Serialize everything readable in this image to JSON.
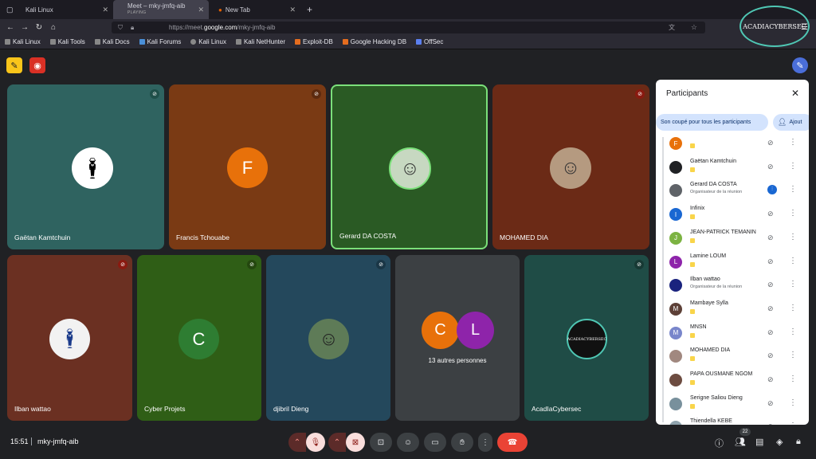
{
  "tabs": [
    {
      "label": "Kali Linux"
    },
    {
      "label": "Meet – mky-jmfq-aib",
      "sub": "PLAYING"
    },
    {
      "label": "New Tab"
    }
  ],
  "url": {
    "prefix": "https://meet.",
    "domain": "google.com",
    "path": "/mky-jmfq-aib"
  },
  "bookmarks": [
    "Kali Linux",
    "Kali Tools",
    "Kali Docs",
    "Kali Forums",
    "Kali Linux",
    "Kali NetHunter",
    "Exploit-DB",
    "Google Hacking DB",
    "OffSec"
  ],
  "watermark": "ACADIACYBERSEC",
  "tiles": [
    {
      "name": "Gaëtan Kamtchuin",
      "avatar": "",
      "bg": "#2f6360"
    },
    {
      "name": "Francis Tchouabe",
      "avatar": "F",
      "bg": "#7a3a14"
    },
    {
      "name": "Gerard DA COSTA",
      "avatar": "",
      "bg": "#2a5a24"
    },
    {
      "name": "MOHAMED DIA",
      "avatar": "",
      "bg": "#6b2a16"
    },
    {
      "name": "Ilban wattao",
      "avatar": "",
      "bg": "#6b3022"
    },
    {
      "name": "Cyber Projets",
      "avatar": "C",
      "bg": "#2f5e16"
    },
    {
      "name": "djibril Dieng",
      "avatar": "",
      "bg": "#24485c"
    },
    {
      "name": "13 autres personnes",
      "avatar": "C",
      "avatar2": "L",
      "bg": "#3c4043"
    },
    {
      "name": "AcadIaCybersec",
      "avatar": "ACADIACYBERSEC",
      "bg": "#1f4c46"
    }
  ],
  "panel": {
    "title": "Participants",
    "mute_all": "Son coupé pour tous les participants",
    "add": "Ajout"
  },
  "participants": [
    {
      "name": "",
      "initial": "F",
      "color": "#e8710a",
      "role": ""
    },
    {
      "name": "Gaëtan Kamtchuin",
      "initial": "",
      "color": "#202124",
      "role": ""
    },
    {
      "name": "Gerard DA COSTA",
      "initial": "",
      "color": "#5f6368",
      "role": "Organisateur de la réunion"
    },
    {
      "name": "Infinix",
      "initial": "I",
      "color": "#1967d2",
      "role": ""
    },
    {
      "name": "JEAN-PATRICK TEMANIN",
      "initial": "J",
      "color": "#7cb342",
      "role": ""
    },
    {
      "name": "Lamine LOUM",
      "initial": "L",
      "color": "#8e24aa",
      "role": ""
    },
    {
      "name": "Ilban wattao",
      "initial": "",
      "color": "#1a237e",
      "role": "Organisateur de la réunion"
    },
    {
      "name": "Mambaye Sylla",
      "initial": "M",
      "color": "#5d4037",
      "role": ""
    },
    {
      "name": "MNSN",
      "initial": "M",
      "color": "#7986cb",
      "role": ""
    },
    {
      "name": "MOHAMED DIA",
      "initial": "",
      "color": "#a1887f",
      "role": ""
    },
    {
      "name": "PAPA OUSMANE NGOM",
      "initial": "",
      "color": "#6d4c41",
      "role": ""
    },
    {
      "name": "Serigne Saliou Dieng",
      "initial": "",
      "color": "#78909c",
      "role": ""
    },
    {
      "name": "Thiendella KEBE",
      "initial": "",
      "color": "#90a4ae",
      "role": ""
    }
  ],
  "bottom": {
    "time": "15:51",
    "code": "mky-jmfq-aib",
    "count": "22"
  }
}
